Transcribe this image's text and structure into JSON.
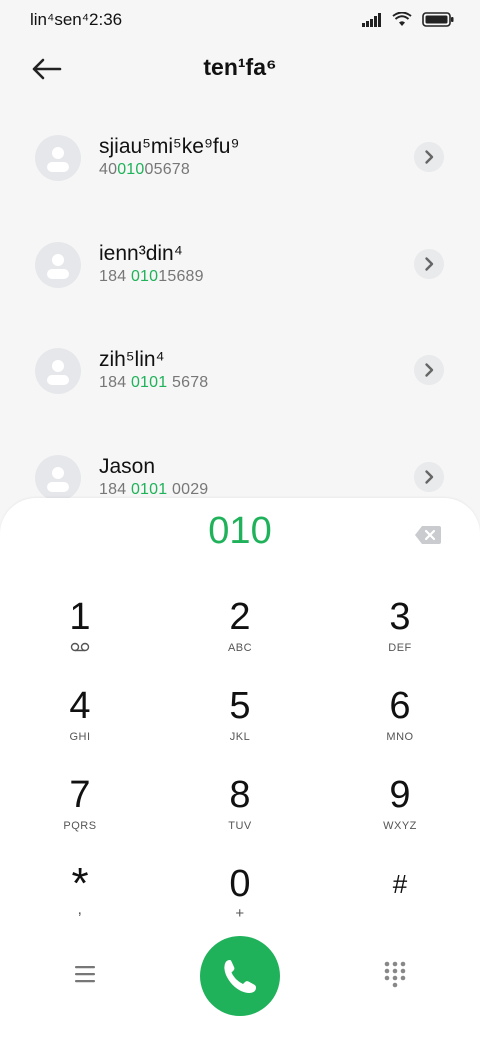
{
  "status": {
    "time": "lin⁴sen⁴2:36",
    "icons": [
      "signal-icon",
      "wifi-icon",
      "battery-icon"
    ]
  },
  "header": {
    "title": "ten¹fa⁶"
  },
  "contacts": [
    {
      "name": "sjiau⁵mi⁵ke⁹fu⁹",
      "num_pre": "40",
      "num_hl": "010",
      "num_post": "05678"
    },
    {
      "name": "ienn³din⁴",
      "num_pre": "184 ",
      "num_hl": "010",
      "num_post": "15689"
    },
    {
      "name": "zih⁵lin⁴",
      "num_pre": "184 ",
      "num_hl": "0101",
      "num_post": " 5678"
    },
    {
      "name": "Jason",
      "num_pre": "184 ",
      "num_hl": "0101",
      "num_post": " 0029"
    }
  ],
  "dialer": {
    "dialed": "010",
    "keys": [
      {
        "digit": "1",
        "letters": ""
      },
      {
        "digit": "2",
        "letters": "ABC"
      },
      {
        "digit": "3",
        "letters": "DEF"
      },
      {
        "digit": "4",
        "letters": "GHI"
      },
      {
        "digit": "5",
        "letters": "JKL"
      },
      {
        "digit": "6",
        "letters": "MNO"
      },
      {
        "digit": "7",
        "letters": "PQRS"
      },
      {
        "digit": "8",
        "letters": "TUV"
      },
      {
        "digit": "9",
        "letters": "WXYZ"
      },
      {
        "digit": "*",
        "letters": ","
      },
      {
        "digit": "0",
        "letters": "+"
      },
      {
        "digit": "#",
        "letters": ""
      }
    ]
  },
  "colors": {
    "accent": "#20b25a",
    "background": "#f6f6f6",
    "panel": "#ffffff"
  }
}
